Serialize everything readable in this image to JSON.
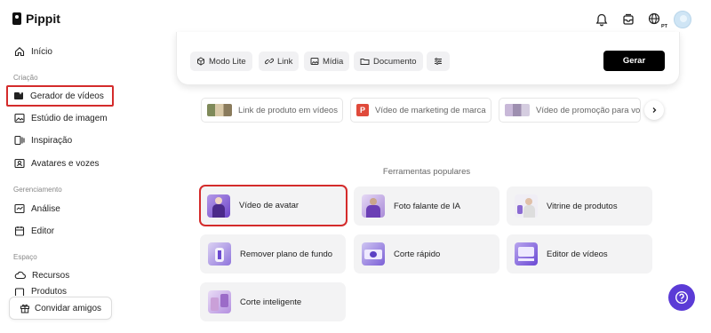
{
  "app": {
    "name": "Pippit"
  },
  "topbar": {
    "icons": [
      "bell-icon",
      "inbox-icon",
      "language-icon",
      "user-avatar"
    ],
    "language_badge": "PT"
  },
  "sidebar": {
    "home": "Início",
    "section_creation": "Criação",
    "video_generator": "Gerador de vídeos",
    "image_studio": "Estúdio de imagem",
    "inspiration": "Inspiração",
    "avatars_voices": "Avatares e vozes",
    "section_management": "Gerenciamento",
    "analytics": "Análise",
    "editor": "Editor",
    "section_space": "Espaço",
    "resources": "Recursos",
    "products_partial": "Produtos",
    "invite_friends": "Convidar amigos"
  },
  "prompt": {
    "chips": [
      "Modo Lite",
      "Link",
      "Mídia",
      "Documento"
    ],
    "generate_label": "Gerar"
  },
  "suggestions": [
    {
      "label": "Link de produto em vídeos"
    },
    {
      "label": "Vídeo de marketing de marca"
    },
    {
      "label": "Vídeo de promoção para volta"
    }
  ],
  "tools_title": "Ferramentas populares",
  "tools": [
    {
      "label": "Vídeo de avatar"
    },
    {
      "label": "Foto falante de IA"
    },
    {
      "label": "Vitrine de produtos"
    },
    {
      "label": "Remover plano de fundo"
    },
    {
      "label": "Corte rápido"
    },
    {
      "label": "Editor de vídeos"
    },
    {
      "label": "Corte inteligente"
    }
  ],
  "colors": {
    "accent_purple": "#5b3bd6",
    "highlight_red": "#d42b2b",
    "card_bg": "#f3f3f4"
  }
}
